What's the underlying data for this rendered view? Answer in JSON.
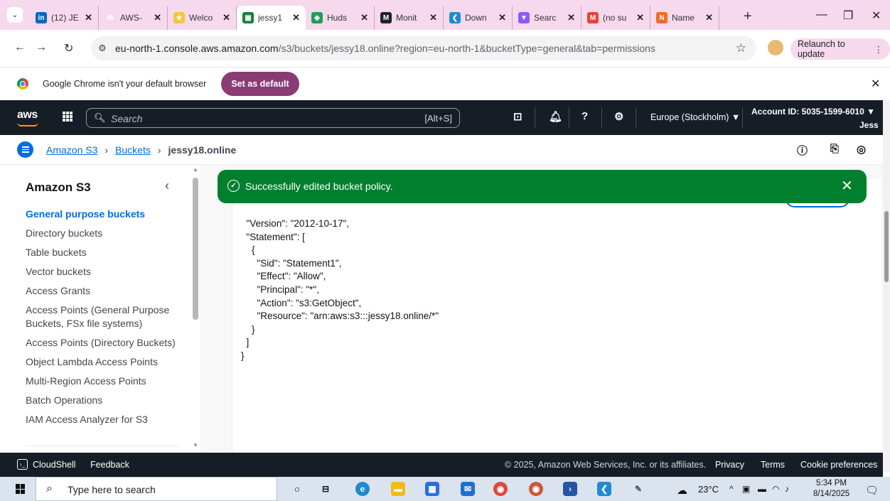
{
  "browser": {
    "tabs": [
      {
        "label": "(12) JE",
        "icon": "linkedin-icon",
        "color": "#0a66c2",
        "glyph": "in"
      },
      {
        "label": "AWS-",
        "icon": "aws-icon",
        "color": "#f7d9ee",
        "glyph": "⁂"
      },
      {
        "label": "Welco",
        "icon": "welcome-icon",
        "color": "#f4c542",
        "glyph": "★"
      },
      {
        "label": "jessy1",
        "icon": "aws-s3-icon",
        "color": "#1b7f3b",
        "glyph": "▣",
        "active": true
      },
      {
        "label": "Huds",
        "icon": "hudson-icon",
        "color": "#1e9e57",
        "glyph": "◆"
      },
      {
        "label": "Monit",
        "icon": "medium-icon",
        "color": "#222222",
        "glyph": "M"
      },
      {
        "label": "Down",
        "icon": "vscode-icon",
        "color": "#1f8ad2",
        "glyph": "❮"
      },
      {
        "label": "Searc",
        "icon": "vite-icon",
        "color": "#8b5cf6",
        "glyph": "▼"
      },
      {
        "label": "(no su",
        "icon": "gmail-icon",
        "color": "#ea4335",
        "glyph": "M"
      },
      {
        "label": "Name",
        "icon": "namecheap-icon",
        "color": "#f46a25",
        "glyph": "N"
      }
    ],
    "url_host": "eu-north-1.console.aws.amazon.com",
    "url_path": "/s3/buckets/jessy18.online?region=eu-north-1&bucketType=general&tab=permissions",
    "relaunch_label": "Relaunch to update",
    "banner_text": "Google Chrome isn't your default browser",
    "set_default_label": "Set as default"
  },
  "aws": {
    "search_placeholder": "Search",
    "search_shortcut": "[Alt+S]",
    "region": "Europe (Stockholm) ▼",
    "account": "Account ID: 5035-1599-6010 ▼",
    "user": "Jess"
  },
  "breadcrumbs": {
    "s3": "Amazon S3",
    "buckets": "Buckets",
    "current": "jessy18.online"
  },
  "sidebar": {
    "title": "Amazon S3",
    "items": [
      {
        "label": "General purpose buckets",
        "active": true
      },
      {
        "label": "Directory buckets"
      },
      {
        "label": "Table buckets"
      },
      {
        "label": "Vector buckets"
      },
      {
        "label": "Access Grants"
      },
      {
        "label": "Access Points (General Purpose Buckets, FSx file systems)"
      },
      {
        "label": "Access Points (Directory Buckets)"
      },
      {
        "label": "Object Lambda Access Points"
      },
      {
        "label": "Multi-Region Access Points"
      },
      {
        "label": "Batch Operations"
      },
      {
        "label": "IAM Access Analyzer for S3"
      }
    ]
  },
  "flash": {
    "message": "Successfully edited bucket policy."
  },
  "policy": {
    "code": "  \"Version\": \"2012-10-17\",\n  \"Statement\": [\n    {\n      \"Sid\": \"Statement1\",\n      \"Effect\": \"Allow\",\n      \"Principal\": \"*\",\n      \"Action\": \"s3:GetObject\",\n      \"Resource\": \"arn:aws:s3:::jessy18.online/*\"\n    }\n  ]\n}"
  },
  "footer": {
    "cloudshell": "CloudShell",
    "feedback": "Feedback",
    "copyright": "© 2025, Amazon Web Services, Inc. or its affiliates.",
    "privacy": "Privacy",
    "terms": "Terms",
    "cookies": "Cookie preferences"
  },
  "taskbar": {
    "search_placeholder": "Type here to search",
    "temperature": "23°C",
    "time": "5:34 PM",
    "date": "8/14/2025"
  }
}
